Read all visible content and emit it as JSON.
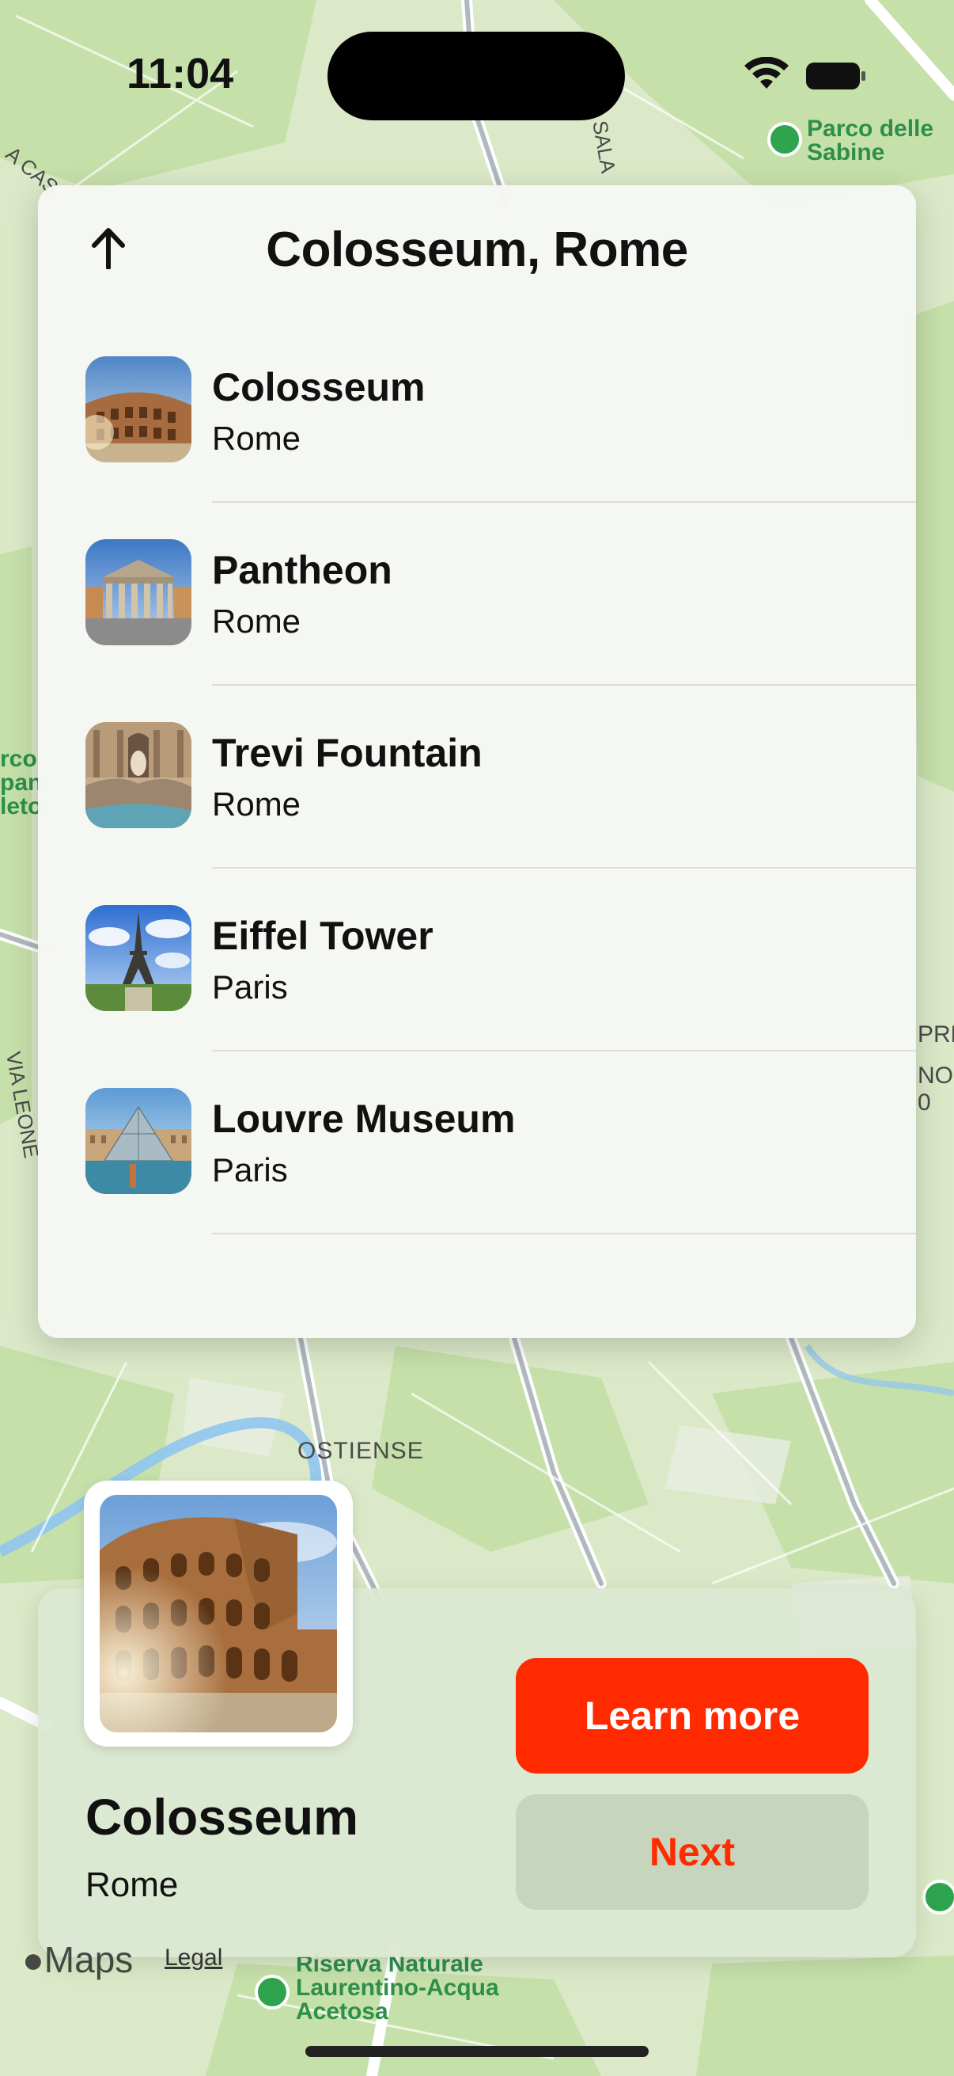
{
  "status_bar": {
    "time": "11:04"
  },
  "map": {
    "labels": {
      "park_top": [
        "Parco delle",
        "Sabine"
      ],
      "street_sala": "SALA",
      "street_cas": "A CAS",
      "ostiense": "OSTIENSE",
      "via_leon": "VIA LEONE",
      "park_bottom": [
        "Riserva Naturale",
        "Laurentino-Acqua",
        "Acetosa"
      ],
      "left_edge": [
        "rco",
        "pan",
        "leto"
      ],
      "right_edge": [
        "PRE",
        "NO-",
        "0"
      ]
    }
  },
  "panel": {
    "title": "Colosseum, Rome",
    "items": [
      {
        "title": "Colosseum",
        "subtitle": "Rome"
      },
      {
        "title": "Pantheon",
        "subtitle": "Rome"
      },
      {
        "title": "Trevi Fountain",
        "subtitle": "Rome"
      },
      {
        "title": "Eiffel Tower",
        "subtitle": "Paris"
      },
      {
        "title": "Louvre Museum",
        "subtitle": "Paris"
      }
    ]
  },
  "card": {
    "title": "Colosseum",
    "subtitle": "Rome",
    "learn_more_label": "Learn more",
    "next_label": "Next"
  },
  "footer": {
    "maps_label": "Maps",
    "legal_label": "Legal"
  },
  "colors": {
    "accent": "#ff2a00",
    "panel_bg": "#f6f7f3",
    "map_green": "#cde4b4"
  },
  "icons": [
    "wifi-icon",
    "battery-icon",
    "arrow-up-icon",
    "tree-icon",
    "apple-logo-icon"
  ]
}
